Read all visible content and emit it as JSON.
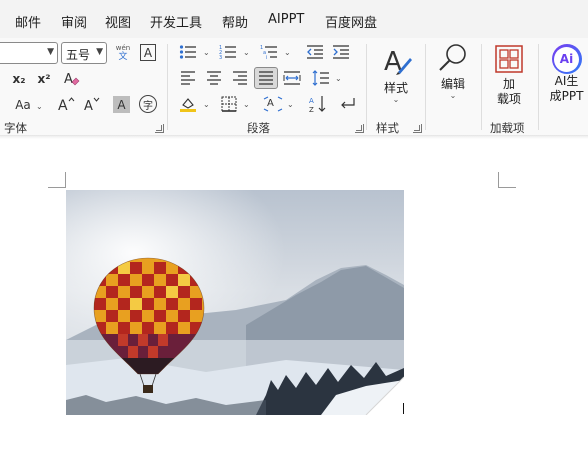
{
  "menu": {
    "tabs": [
      "邮件",
      "审阅",
      "视图",
      "开发工具",
      "帮助",
      "AIPPT",
      "百度网盘"
    ]
  },
  "font_group": {
    "font_size_value": "五号",
    "phonetic_top": "wén",
    "phonetic_bottom": "文",
    "border_char": "A",
    "subscript": "x₂",
    "superscript": "x²",
    "change_case": "Aa",
    "grow_font": "A^",
    "shrink_font": "Aˇ",
    "shading_char": "A",
    "enclose_char": "字",
    "label": "字体"
  },
  "paragraph_group": {
    "label": "段落"
  },
  "styles_group": {
    "button_label": "样式",
    "label": "样式"
  },
  "editing_group": {
    "button_label": "编辑"
  },
  "addins_group": {
    "button_label_line1": "加",
    "button_label_line2": "载项",
    "label": "加载项"
  },
  "ai_group": {
    "badge": "Ai",
    "button_label_line1": "AI生",
    "button_label_line2": "成PPT"
  },
  "colors": {
    "accent_addins": "#c0392b",
    "ai_purple": "#7a3cf0",
    "ai_blue": "#2f7cf6"
  }
}
